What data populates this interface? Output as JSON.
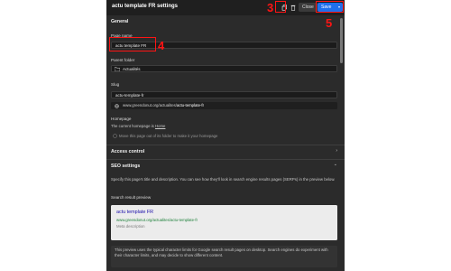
{
  "header": {
    "title": "actu template FR settings",
    "close_label": "Close",
    "save_label": "Save",
    "save_caret": "▾"
  },
  "annotations": {
    "n3": "3",
    "n4": "4",
    "n5": "5"
  },
  "general": {
    "heading": "General",
    "page_name_label": "Page name",
    "page_name_value": "actu template FR",
    "parent_folder_label": "Parent folder",
    "parent_folder_value": "Actualités",
    "slug_label": "Slug",
    "slug_value": "actu-template-fr",
    "url_prefix": "www.greendonut.org/actualites/",
    "url_slug": "actu-template-fr",
    "homepage_label": "Homepage",
    "homepage_text": "The current homepage is ",
    "homepage_link": "Home",
    "move_text": "Move this page out of its folder to make it your homepage"
  },
  "access_control": {
    "heading": "Access control",
    "chevron": "›"
  },
  "seo": {
    "heading": "SEO settings",
    "chevron": "⌄",
    "description": "Specify this page's title and description. You can see how they'll look in search engine results pages (SERPs) in the preview below.",
    "preview_label": "Search result preview",
    "preview_title": "actu template FR",
    "preview_url": "www.greendonut.org/actualites/actu-template-fr",
    "preview_desc": "Meta description",
    "note": "This preview uses the typical character limits for Google search result pages on desktop. Search engines do experiment with their character limits, and may decide to show different content."
  },
  "colors": {
    "panel_bg": "#2b2b2b",
    "header_bg": "#1f1f1f",
    "accent": "#1f6feb",
    "annotation": "#ff1414"
  }
}
